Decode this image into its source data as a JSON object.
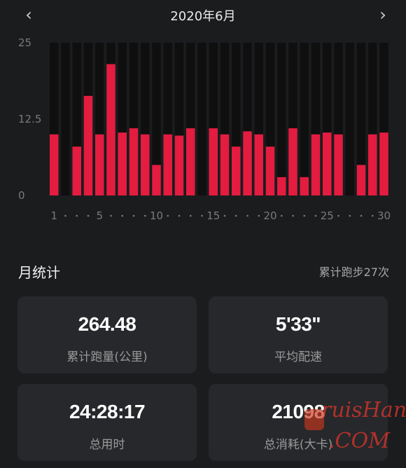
{
  "header": {
    "title": "2020年6月",
    "prev_icon": "‹",
    "next_icon": "›"
  },
  "chart_data": {
    "type": "bar",
    "x_tick_labels": [
      "1",
      "5",
      "10",
      "15",
      "20",
      "25",
      "30"
    ],
    "y_tick_labels": [
      "25",
      "12.5",
      "0"
    ],
    "ylim": [
      0,
      25
    ],
    "categories": [
      1,
      2,
      3,
      4,
      5,
      6,
      7,
      8,
      9,
      10,
      11,
      12,
      13,
      14,
      15,
      16,
      17,
      18,
      19,
      20,
      21,
      22,
      23,
      24,
      25,
      26,
      27,
      28,
      29,
      30
    ],
    "values": [
      10,
      0,
      8,
      16.3,
      10,
      21.5,
      10.3,
      11,
      10,
      5,
      10,
      9.8,
      11,
      0,
      11,
      10,
      8,
      10.5,
      10,
      8,
      3,
      11,
      3,
      10,
      10.3,
      10,
      0,
      5,
      10,
      10.3
    ],
    "colors": {
      "bar": "#e31c40",
      "slot": "#0f0f0f",
      "axis_text": "#7a7a7a"
    }
  },
  "stats": {
    "title": "月统计",
    "summary": "累计跑步27次",
    "cards": [
      {
        "value": "264.48",
        "label": "累计跑量(公里)"
      },
      {
        "value": "5'33\"",
        "label": "平均配速"
      },
      {
        "value": "24:28:17",
        "label": "总用时"
      },
      {
        "value": "21098",
        "label": "总消耗(大卡)"
      }
    ]
  },
  "watermark": {
    "line1": "ruisHan",
    "line2": ".COM"
  }
}
